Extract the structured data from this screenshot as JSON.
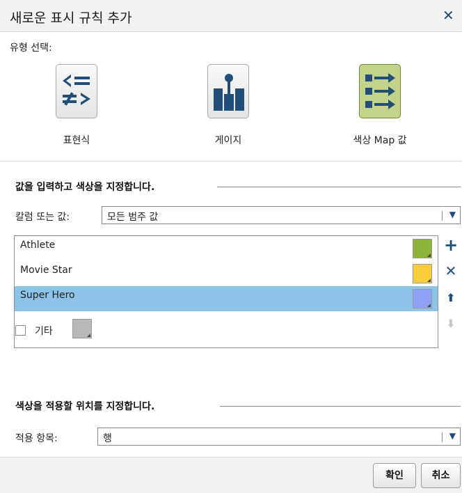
{
  "dialog": {
    "title": "새로운 표시 규칙 추가",
    "close_glyph": "✕"
  },
  "type_select": {
    "label": "유형 선택:",
    "options": [
      {
        "label": "표현식",
        "icon": "expression-icon",
        "selected": false
      },
      {
        "label": "게이지",
        "icon": "gauge-icon",
        "selected": false
      },
      {
        "label": "색상 Map 값",
        "icon": "color-map-icon",
        "selected": true
      }
    ]
  },
  "value_section": {
    "title": "값을 입력하고 색상을 지정합니다.",
    "column_label": "칼럼 또는 값:",
    "column_value": "모든 범주 값",
    "items": [
      {
        "label": "Athlete",
        "color": "#8db33a",
        "selected": false
      },
      {
        "label": "Movie Star",
        "color": "#f9ce3d",
        "selected": false
      },
      {
        "label": "Super Hero",
        "color": "#8fa1f3",
        "selected": true
      }
    ],
    "actions": {
      "add": "+",
      "remove": "✕",
      "up": "⬆",
      "down": "⬇"
    },
    "other": {
      "label": "기타",
      "checked": false,
      "color": "#b8b8b8"
    }
  },
  "apply_section": {
    "title": "색상을 적용할 위치를 지정합니다.",
    "apply_label": "적용 항목:",
    "apply_value": "행"
  },
  "footer": {
    "ok": "확인",
    "cancel": "취소"
  }
}
